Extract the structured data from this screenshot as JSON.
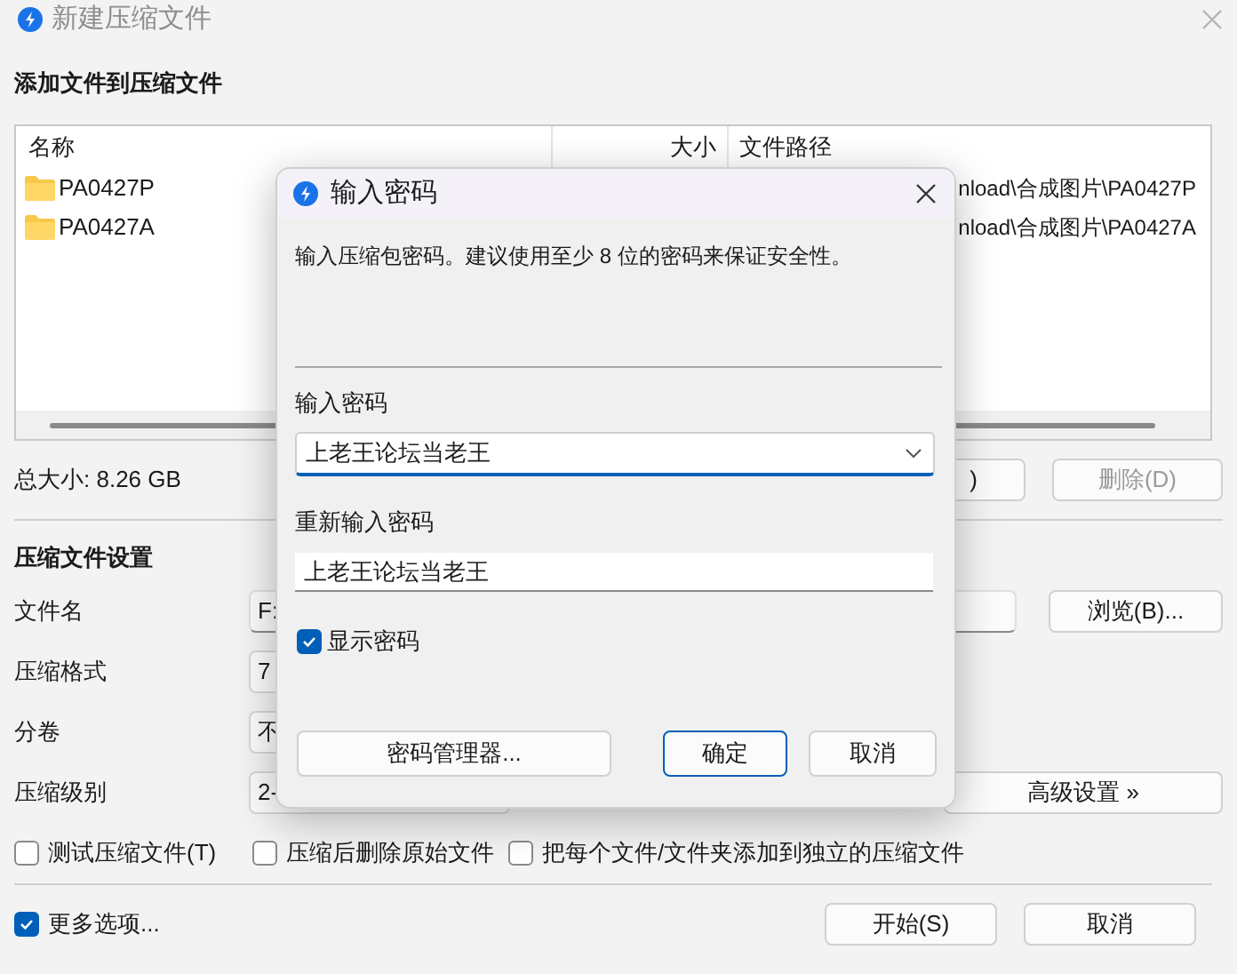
{
  "window": {
    "title": "新建压缩文件"
  },
  "files": {
    "heading": "添加文件到压缩文件",
    "columns": [
      "名称",
      "大小",
      "文件路径"
    ],
    "rows": [
      {
        "name": "PA0427P",
        "path": "nload\\合成图片\\PA0427P"
      },
      {
        "name": "PA0427A",
        "path": "nload\\合成图片\\PA0427A"
      }
    ]
  },
  "total_size": "总大小: 8.26 GB",
  "list_buttons": [
    {
      "label": ")",
      "disabled": false
    },
    {
      "label": "删除(D)",
      "disabled": true
    }
  ],
  "settings": {
    "heading": "压缩文件设置",
    "fields": [
      {
        "kind": "text",
        "label": "文件名",
        "value": "F:"
      },
      {
        "kind": "combo",
        "label": "压缩格式",
        "value": "7"
      },
      {
        "kind": "combo",
        "label": "分卷",
        "value": "不"
      },
      {
        "kind": "combo",
        "label": "压缩级别",
        "value": "2-"
      }
    ],
    "browse_button": "浏览(B)...",
    "advanced_button": "高级设置 »",
    "options": [
      {
        "label": "测试压缩文件(T)",
        "checked": false
      },
      {
        "label": "压缩后删除原始文件",
        "checked": false
      },
      {
        "label": "把每个文件/文件夹添加到独立的压缩文件",
        "checked": false
      }
    ]
  },
  "more_options": {
    "label": "更多选项...",
    "checked": true
  },
  "footer_buttons": [
    "开始(S)",
    "取消"
  ],
  "dialog": {
    "title": "输入密码",
    "description": "输入压缩包密码。建议使用至少 8 位的密码来保证安全性。",
    "password_label": "输入密码",
    "password": "上老王论坛当老王",
    "confirm_label": "重新输入密码",
    "confirm": "上老王论坛当老王",
    "show_password": {
      "label": "显示密码",
      "checked": true
    },
    "manager_button": "密码管理器...",
    "buttons": [
      {
        "label": "确定",
        "default": true
      },
      {
        "label": "取消",
        "default": false
      }
    ]
  }
}
